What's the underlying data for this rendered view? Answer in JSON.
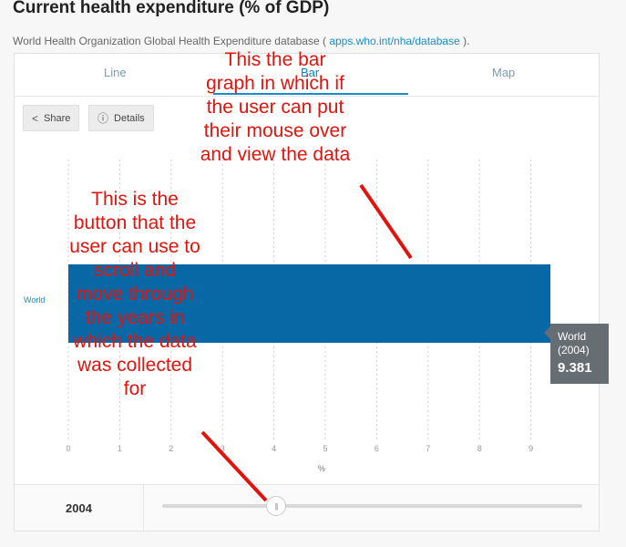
{
  "page": {
    "title": "Current health expenditure (% of GDP)",
    "source_text": "World Health Organization Global Health Expenditure database ( ",
    "source_link": "apps.who.int/nha/database",
    "source_suffix": " )."
  },
  "tabs": [
    {
      "label": "Line",
      "active": false
    },
    {
      "label": "Bar",
      "active": true
    },
    {
      "label": "Map",
      "active": false
    }
  ],
  "buttons": {
    "share": "Share",
    "details": "Details"
  },
  "chart_data": {
    "type": "bar",
    "orientation": "horizontal",
    "categories": [
      "World"
    ],
    "values": [
      9.381
    ],
    "xlabel": "%",
    "xlim": [
      0,
      9.5
    ],
    "xticks": [
      "0",
      "1",
      "2",
      "3",
      "4",
      "5",
      "6",
      "7",
      "8",
      "9"
    ],
    "grid": true,
    "bar_color": "#0868a6"
  },
  "tooltip": {
    "name": "World",
    "year": "(2004)",
    "value": "9.381"
  },
  "slider": {
    "year": "2004",
    "position": 0.28
  },
  "annotations": {
    "note1": [
      "This the bar",
      "graph in which if",
      "the user can put",
      "their mouse over",
      "and view the data"
    ],
    "note2": [
      "This is the",
      "button that the",
      "user can use to",
      "scroll and",
      "move through",
      "the years in",
      "which the data",
      "was collected",
      "for"
    ]
  },
  "colors": {
    "accent": "#1a8cc9",
    "annotation": "#e0140f"
  }
}
